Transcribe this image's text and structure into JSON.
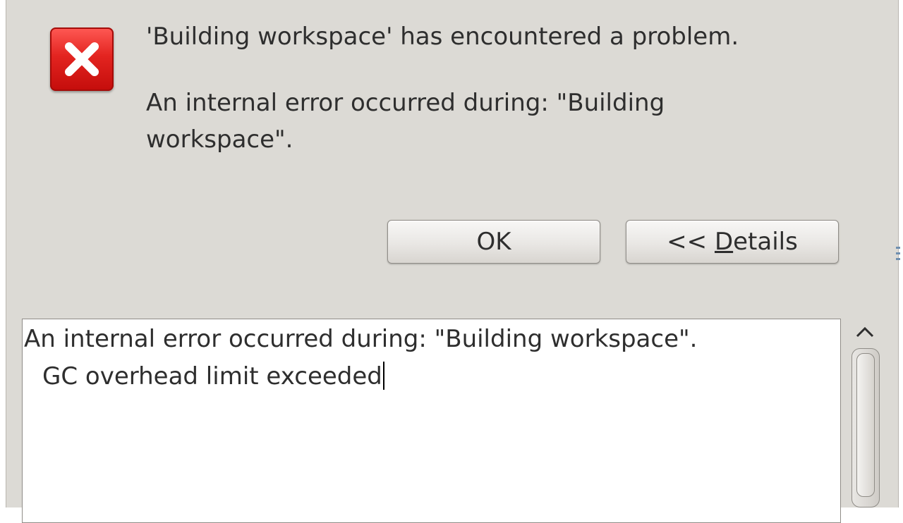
{
  "dialog": {
    "title": "'Building workspace' has encountered a problem.",
    "message": "An internal error occurred during: \"Building workspace\".",
    "icon": "error-icon",
    "buttons": {
      "ok_label": "OK",
      "details_prefix": "<< ",
      "details_mnemonic": "D",
      "details_rest": "etails"
    },
    "details": {
      "line1": "An internal error occurred during: \"Building workspace\".",
      "line2": "GC overhead limit exceeded"
    }
  },
  "colors": {
    "icon_red": "#e32420",
    "window_bg": "#dcdad5"
  }
}
